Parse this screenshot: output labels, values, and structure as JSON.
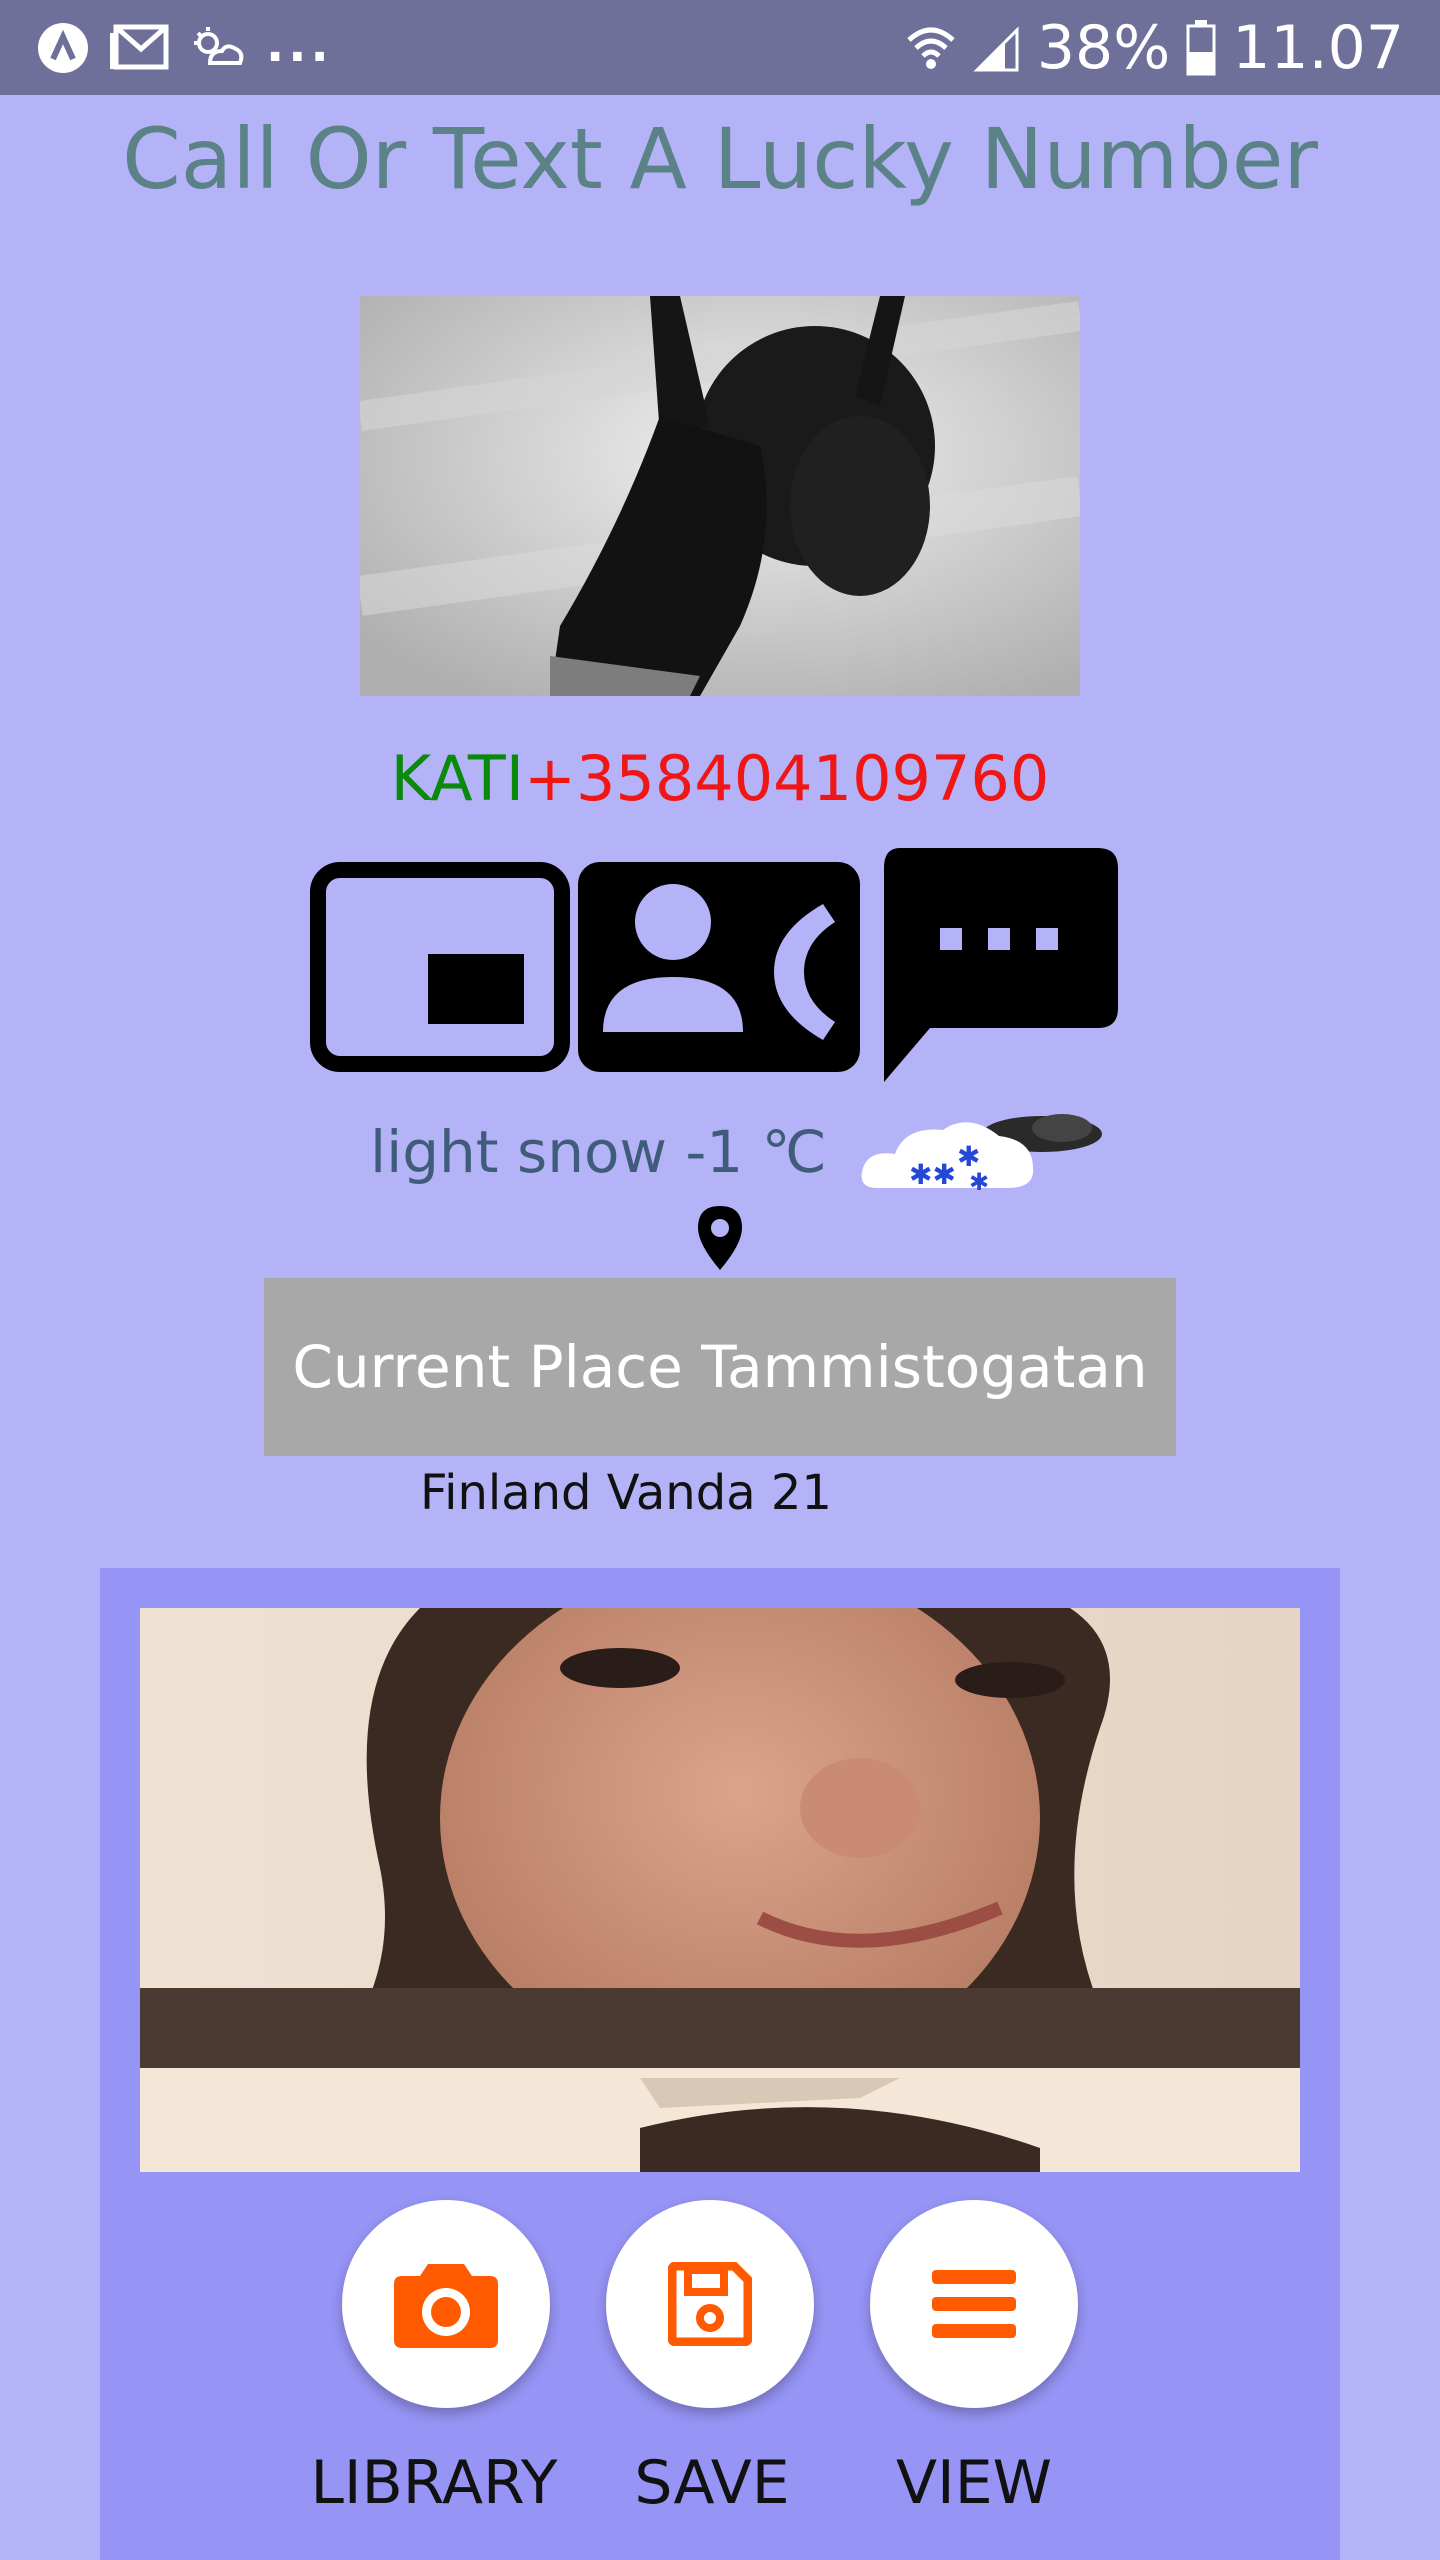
{
  "status_bar": {
    "battery": "38%",
    "time": "11.07",
    "overflow": "...",
    "icons": [
      "assistant-icon",
      "gmail-icon",
      "weather-sync-icon",
      "wifi-icon",
      "signal-icon",
      "battery-icon"
    ]
  },
  "title": "Call Or Text A Lucky Number",
  "contact": {
    "name": "KATI",
    "number": "+358404109760"
  },
  "actions": {
    "icons": [
      "video-call-icon",
      "contact-phone-icon",
      "message-icon"
    ]
  },
  "weather": {
    "text": "light snow -1 ℃",
    "icon": "snow-cloud-icon"
  },
  "location": {
    "pin_icon": "location-pin-icon",
    "button_label": "Current Place Tammistogatan",
    "address": "Finland Vanda 21"
  },
  "buttons": {
    "library": "LIBRARY",
    "save": "SAVE",
    "view": "VIEW"
  },
  "colors": {
    "background": "#b5b3f8",
    "panel": "#9694f5",
    "accent_orange": "#ff5a00",
    "name_green": "#0a8a0a",
    "number_red": "#f01616"
  }
}
